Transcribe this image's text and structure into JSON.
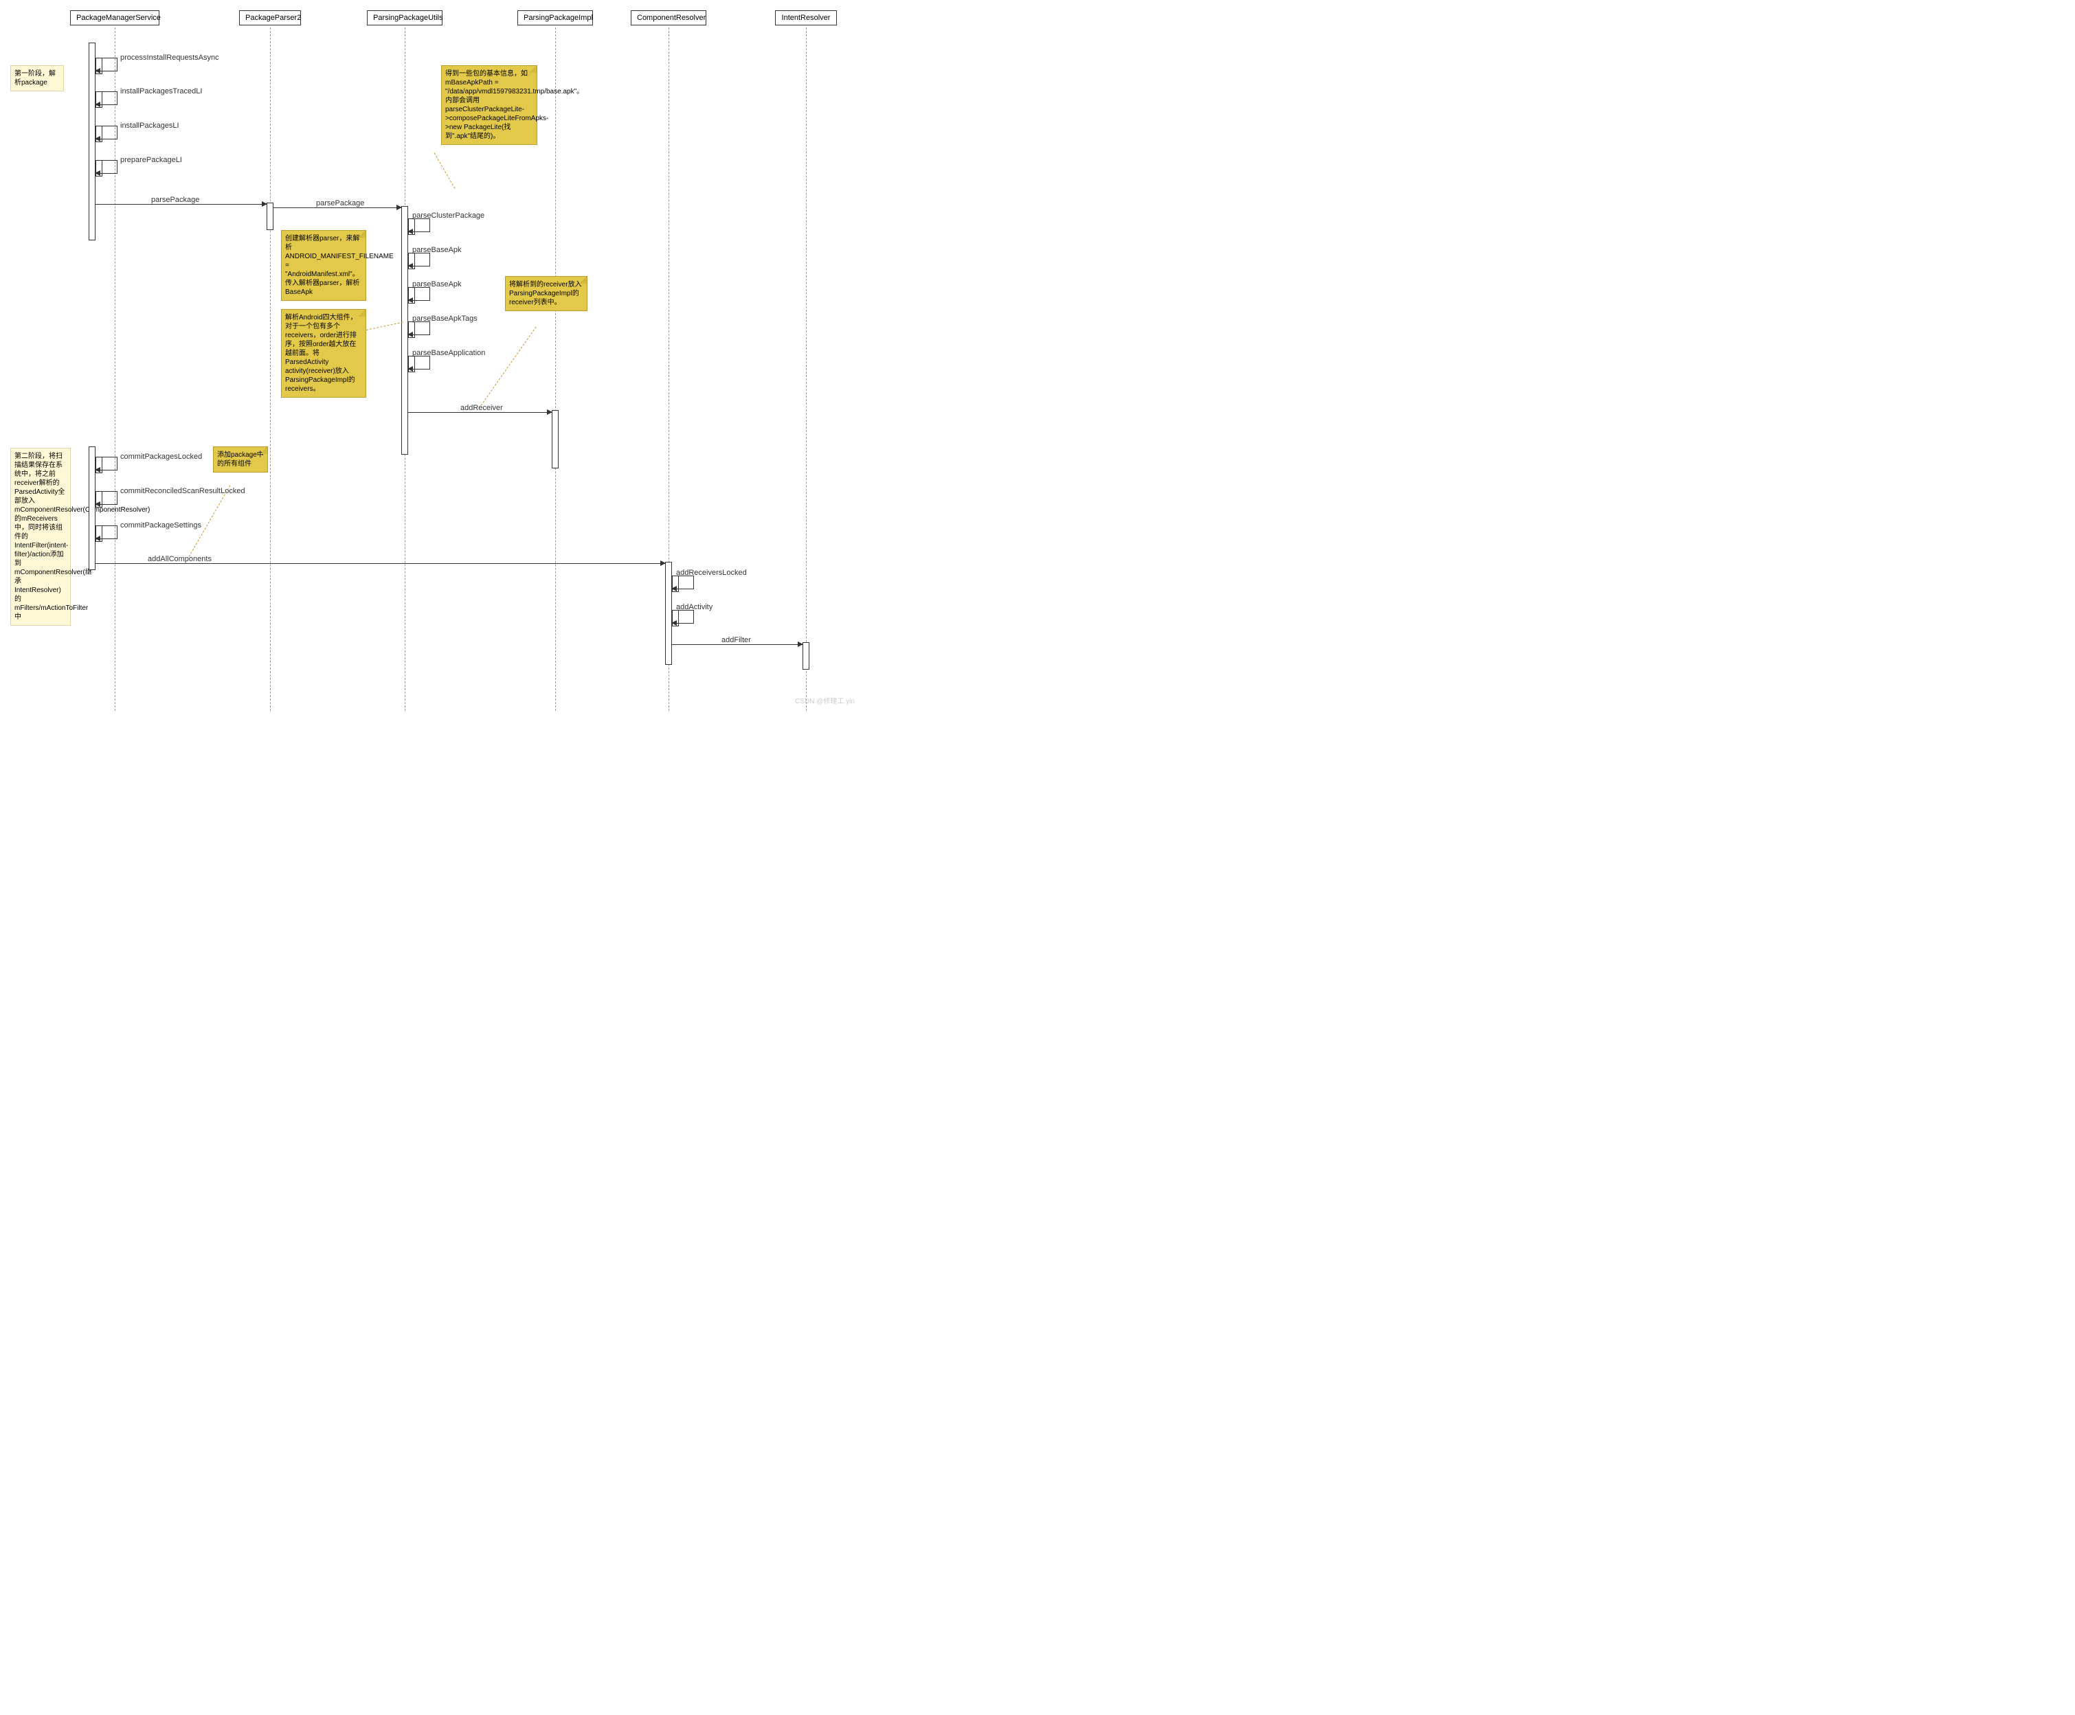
{
  "lifelines": {
    "pms": "PackageManagerService",
    "pp2": "PackageParser2",
    "ppu": "ParsingPackageUtils",
    "ppi": "ParsingPackageImpl",
    "cr": "ComponentResolver",
    "ir": "IntentResolver"
  },
  "messages": {
    "m1": "processInstallRequestsAsync",
    "m2": "installPackagesTracedLI",
    "m3": "installPackagesLI",
    "m4": "preparePackageLI",
    "m5": "parsePackage",
    "m6": "parsePackage",
    "m7": "parseClusterPackage",
    "m8": "parseBaseApk",
    "m9": "parseBaseApk",
    "m10": "parseBaseApkTags",
    "m11": "parseBaseApplication",
    "m12": "addReceiver",
    "m13": "commitPackagesLocked",
    "m14": "commitReconciledScanResultLocked",
    "m15": "commitPackageSettings",
    "m16": "addAllComponents",
    "m17": "addReceiversLocked",
    "m18": "addActivity",
    "m19": "addFilter"
  },
  "notes": {
    "n1": "得到一些包的基本信息，如mBaseApkPath = \"/data/app/vmdl1597983231.tmp/base.apk\"。内部会调用parseClusterPackageLite->composePackageLiteFromApks->new PackageLite(找到\".apk\"结尾的)。",
    "n2": "创建解析器parser，来解析ANDROID_MANIFEST_FILENAME = \"AndroidManifest.xml\"。传入解析器parser，解析BaseApk",
    "n3": "解析Android四大组件，对于一个包有多个receivers，order进行排序，按照order越大放在越前面。将ParsedActivity activity(receiver)放入ParsingPackageImpl的receivers。",
    "n4": "将解析到的receiver放入ParsingPackageImpl的receiver列表中。",
    "n5": "添加package中的所有组件"
  },
  "side_notes": {
    "s1": "第一阶段，解析package",
    "s2": "第二阶段，将扫描结果保存在系统中，将之前receiver解析的ParsedActivity全部放入mComponentResolver(ComponentResolver)的mReceivers中，同时将该组件的IntentFilter(intent-filter)/action添加到mComponentResolver(继承IntentResolver)的mFilters/mActionToFilter中"
  },
  "watermark": "CSDN @修理工.yin",
  "chart_data": {
    "type": "sequence-diagram",
    "participants": [
      "PackageManagerService",
      "PackageParser2",
      "ParsingPackageUtils",
      "ParsingPackageImpl",
      "ComponentResolver",
      "IntentResolver"
    ],
    "interactions": [
      {
        "from": "PackageManagerService",
        "to": "PackageManagerService",
        "label": "processInstallRequestsAsync"
      },
      {
        "from": "PackageManagerService",
        "to": "PackageManagerService",
        "label": "installPackagesTracedLI"
      },
      {
        "from": "PackageManagerService",
        "to": "PackageManagerService",
        "label": "installPackagesLI"
      },
      {
        "from": "PackageManagerService",
        "to": "PackageManagerService",
        "label": "preparePackageLI"
      },
      {
        "from": "PackageManagerService",
        "to": "PackageParser2",
        "label": "parsePackage"
      },
      {
        "from": "PackageParser2",
        "to": "ParsingPackageUtils",
        "label": "parsePackage"
      },
      {
        "from": "ParsingPackageUtils",
        "to": "ParsingPackageUtils",
        "label": "parseClusterPackage",
        "note": "得到一些包的基本信息，如mBaseApkPath = \"/data/app/vmdl1597983231.tmp/base.apk\"。内部会调用parseClusterPackageLite->composePackageLiteFromApks->new PackageLite(找到\".apk\"结尾的)。"
      },
      {
        "from": "ParsingPackageUtils",
        "to": "ParsingPackageUtils",
        "label": "parseBaseApk",
        "note": "创建解析器parser，来解析ANDROID_MANIFEST_FILENAME = \"AndroidManifest.xml\"。传入解析器parser，解析BaseApk"
      },
      {
        "from": "ParsingPackageUtils",
        "to": "ParsingPackageUtils",
        "label": "parseBaseApk"
      },
      {
        "from": "ParsingPackageUtils",
        "to": "ParsingPackageUtils",
        "label": "parseBaseApkTags",
        "note": "将解析到的receiver放入ParsingPackageImpl的receiver列表中。"
      },
      {
        "from": "ParsingPackageUtils",
        "to": "ParsingPackageUtils",
        "label": "parseBaseApplication",
        "note": "解析Android四大组件，对于一个包有多个receivers，order进行排序，按照order越大放在越前面。将ParsedActivity activity(receiver)放入ParsingPackageImpl的receivers。"
      },
      {
        "from": "ParsingPackageUtils",
        "to": "ParsingPackageImpl",
        "label": "addReceiver"
      },
      {
        "from": "PackageManagerService",
        "to": "PackageManagerService",
        "label": "commitPackagesLocked"
      },
      {
        "from": "PackageManagerService",
        "to": "PackageManagerService",
        "label": "commitReconciledScanResultLocked"
      },
      {
        "from": "PackageManagerService",
        "to": "PackageManagerService",
        "label": "commitPackageSettings",
        "note": "添加package中的所有组件"
      },
      {
        "from": "PackageManagerService",
        "to": "ComponentResolver",
        "label": "addAllComponents"
      },
      {
        "from": "ComponentResolver",
        "to": "ComponentResolver",
        "label": "addReceiversLocked"
      },
      {
        "from": "ComponentResolver",
        "to": "ComponentResolver",
        "label": "addActivity"
      },
      {
        "from": "ComponentResolver",
        "to": "IntentResolver",
        "label": "addFilter"
      }
    ],
    "phase_notes": [
      {
        "text": "第一阶段，解析package",
        "from_step": 1,
        "to_step": 12
      },
      {
        "text": "第二阶段，将扫描结果保存在系统中，将之前receiver解析的ParsedActivity全部放入mComponentResolver(ComponentResolver)的mReceivers中，同时将该组件的IntentFilter(intent-filter)/action添加到mComponentResolver(继承IntentResolver)的mFilters/mActionToFilter中",
        "from_step": 13,
        "to_step": 19
      }
    ]
  }
}
